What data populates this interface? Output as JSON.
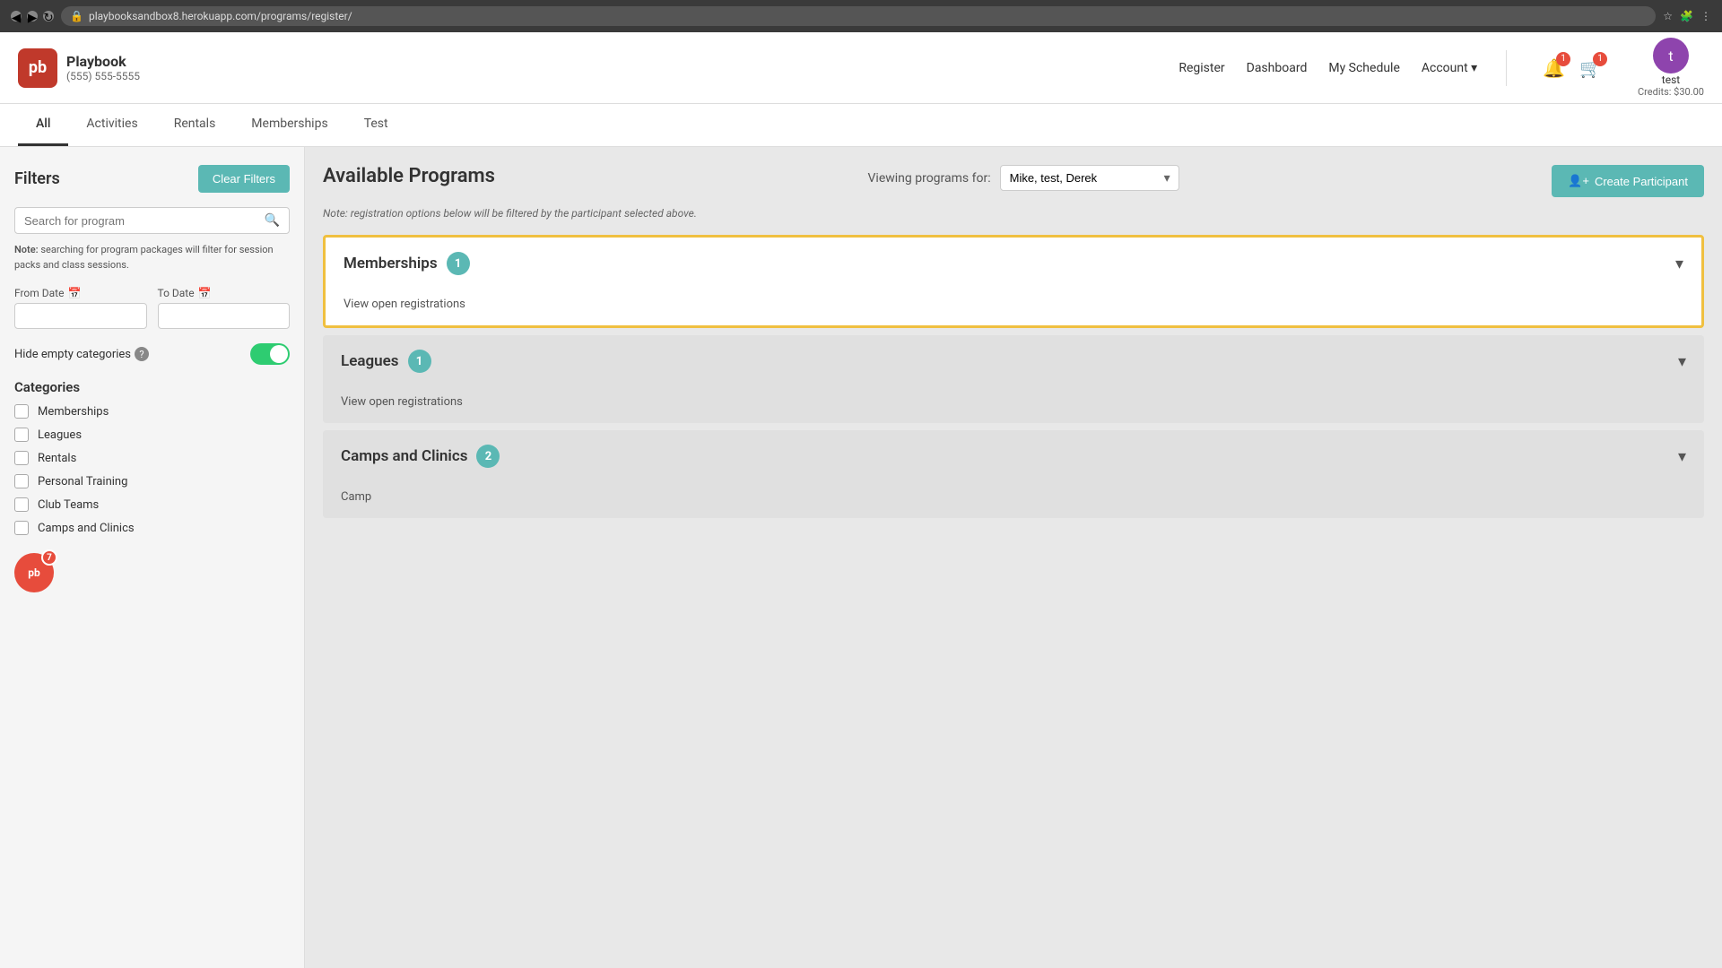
{
  "browser": {
    "url": "playbooksandbox8.herokuapp.com/programs/register/",
    "back_icon": "◀",
    "forward_icon": "▶",
    "reload_icon": "↻"
  },
  "header": {
    "logo_initials": "pb",
    "app_name": "Playbook",
    "phone": "(555) 555-5555",
    "nav": {
      "register": "Register",
      "dashboard": "Dashboard",
      "my_schedule": "My Schedule",
      "account": "Account ▾"
    },
    "notification_count": "1",
    "cart_count": "1",
    "user_initial": "t",
    "user_name": "test",
    "user_credits": "Credits: $30.00"
  },
  "tabs": [
    {
      "label": "All",
      "active": true
    },
    {
      "label": "Activities",
      "active": false
    },
    {
      "label": "Rentals",
      "active": false
    },
    {
      "label": "Memberships",
      "active": false
    },
    {
      "label": "Test",
      "active": false
    }
  ],
  "sidebar": {
    "filters_title": "Filters",
    "clear_filters_label": "Clear Filters",
    "search_placeholder": "Search for program",
    "search_icon": "🔍",
    "note": "Note: searching for program packages will filter for session packs and class sessions.",
    "from_date_label": "From Date",
    "to_date_label": "To Date",
    "from_date_icon": "📅",
    "to_date_icon": "📅",
    "hide_empty_label": "Hide empty categories",
    "hide_empty_help": "?",
    "categories_title": "Categories",
    "categories": [
      {
        "label": "Memberships",
        "checked": false
      },
      {
        "label": "Leagues",
        "checked": false
      },
      {
        "label": "Rentals",
        "checked": false
      },
      {
        "label": "Personal Training",
        "checked": false
      },
      {
        "label": "Club Teams",
        "checked": false
      },
      {
        "label": "Camps and Clinics",
        "checked": false
      }
    ],
    "bottom_badge_count": "7"
  },
  "programs": {
    "title": "Available Programs",
    "viewing_label": "Viewing programs for:",
    "participant_value": "Mike, test, Derek",
    "note_registration": "Note: registration options below will be filtered by the participant selected above.",
    "create_participant_icon": "👤+",
    "create_participant_label": "Create Participant",
    "cards": [
      {
        "title": "Memberships",
        "count": "1",
        "sub": "View open registrations",
        "highlighted": true,
        "expanded": true
      },
      {
        "title": "Leagues",
        "count": "1",
        "sub": "View open registrations",
        "highlighted": false,
        "expanded": true
      },
      {
        "title": "Camps and Clinics",
        "count": "2",
        "sub": "Camp",
        "highlighted": false,
        "expanded": true
      }
    ]
  }
}
